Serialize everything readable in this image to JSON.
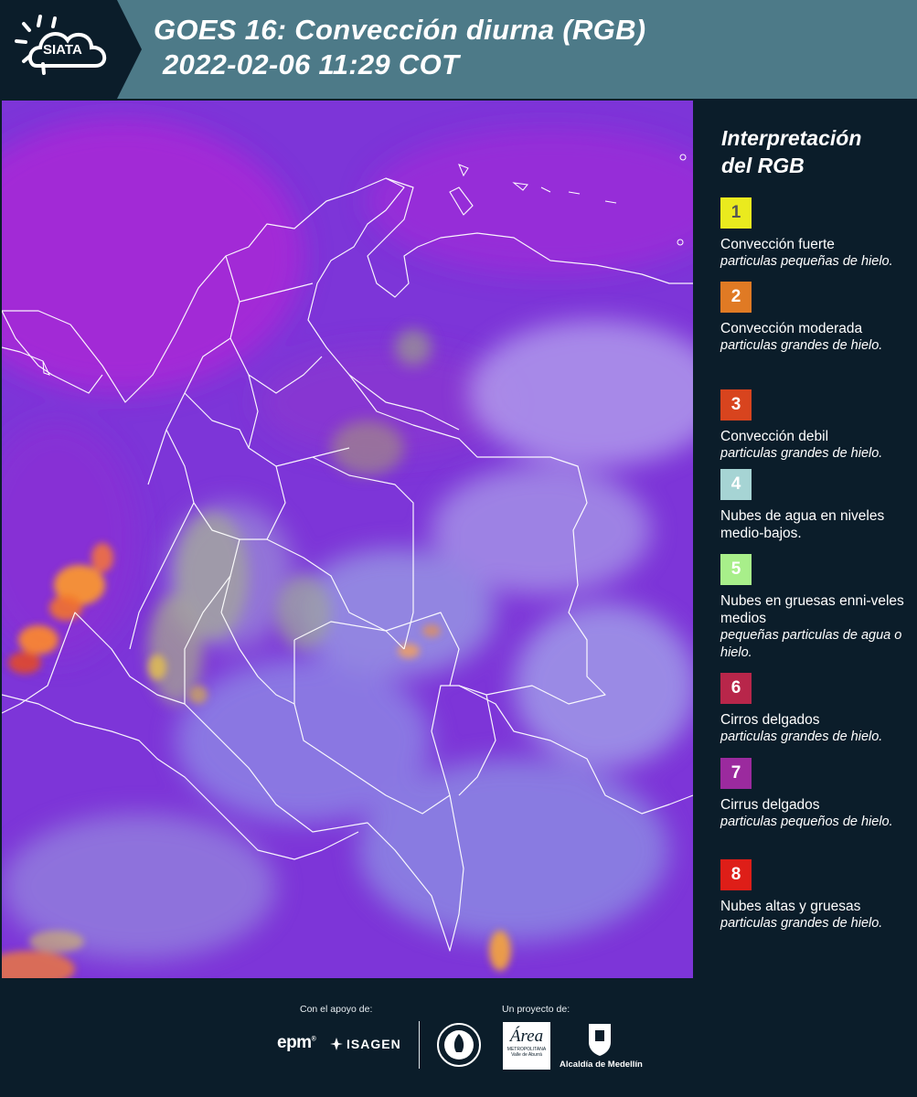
{
  "header": {
    "logo_text": "SIATA",
    "title_line1": "GOES 16: Convección diurna (RGB)",
    "title_line2": "2022-02-06 11:29 COT"
  },
  "colors": {
    "header_bg": "#4d7a88",
    "logo_bg": "#0b1d2a",
    "page_bg": "#0b1d2a",
    "map_base": "#7d35d8"
  },
  "legend": {
    "title": "Interpretación del RGB",
    "items": [
      {
        "number": "1",
        "color": "#eaea1e",
        "number_color": "#555555",
        "main": "Convección fuerte",
        "sub": "particulas pequeñas de hielo."
      },
      {
        "number": "2",
        "color": "#e07a24",
        "number_color": "#ffffff",
        "main": "Convección moderada",
        "sub": "particulas grandes de hielo."
      },
      {
        "number": "3",
        "color": "#d8441e",
        "number_color": "#ffffff",
        "main": "Convección debil",
        "sub": "particulas grandes de hielo."
      },
      {
        "number": "4",
        "color": "#a6d4d4",
        "number_color": "#ffffff",
        "main": "Nubes de agua en niveles medio-bajos.",
        "sub": ""
      },
      {
        "number": "5",
        "color": "#a8ef8a",
        "number_color": "#ffffff",
        "main": "Nubes en gruesas enni-veles medios",
        "sub": "pequeñas particulas de agua o hielo."
      },
      {
        "number": "6",
        "color": "#b8264a",
        "number_color": "#ffffff",
        "main": "Cirros delgados",
        "sub": "particulas grandes de hielo."
      },
      {
        "number": "7",
        "color": "#9b2a9e",
        "number_color": "#ffffff",
        "main": "Cirrus delgados",
        "sub": "particulas pequeños de hielo."
      },
      {
        "number": "8",
        "color": "#de1e18",
        "number_color": "#ffffff",
        "main": "Nubes altas y gruesas",
        "sub": "particulas grandes de hielo."
      }
    ]
  },
  "footer": {
    "support_label": "Con el apoyo de:",
    "project_label": "Un proyecto de:",
    "sponsor_epm": "epm",
    "sponsor_isagen": "ISAGEN",
    "area_name": "Área",
    "area_sub1": "METROPOLITANA",
    "area_sub2": "Valle de Aburrá",
    "alcaldia": "Alcaldía de Medellín"
  }
}
